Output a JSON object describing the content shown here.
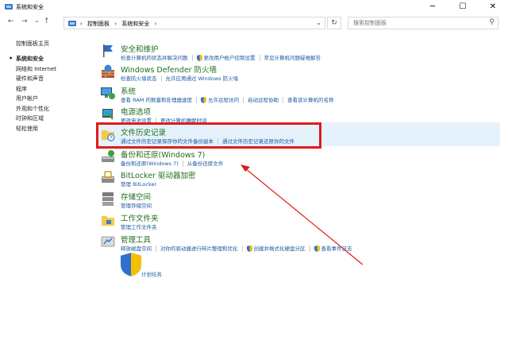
{
  "window": {
    "title": "系统和安全",
    "minimize": "─",
    "maximize": "☐",
    "close": "✕"
  },
  "address": {
    "back": "←",
    "forward": "→",
    "down": "⌄",
    "up": "↑",
    "crumbs": [
      "›",
      "控制面板",
      "›",
      "系统和安全",
      "›"
    ],
    "dropdown": "⌄",
    "refresh": "↻",
    "search_placeholder": "搜索控制面板",
    "search_icon": "⚲"
  },
  "sidebar": {
    "home": "控制面板主页",
    "items": [
      {
        "label": "系统和安全",
        "active": true
      },
      {
        "label": "网络和 Internet"
      },
      {
        "label": "硬件和声音"
      },
      {
        "label": "程序"
      },
      {
        "label": "用户帐户"
      },
      {
        "label": "外观和个性化"
      },
      {
        "label": "时钟和区域"
      },
      {
        "label": "轻松使用"
      }
    ]
  },
  "categories": {
    "security": {
      "title": "安全和维护",
      "links": [
        "检查计算机的状态并解决问题",
        "更改用户帐户控制设置",
        "常见计算机问题疑难解答"
      ]
    },
    "firewall": {
      "title": "Windows Defender 防火墙",
      "links": [
        "检查防火墙状态",
        "允许应用通过 Windows 防火墙"
      ]
    },
    "system": {
      "title": "系统",
      "links": [
        "查看 RAM 的数量和处理器速度",
        "允许远程访问",
        "启动远程协助",
        "查看该计算机的名称"
      ]
    },
    "power": {
      "title": "电源选项",
      "links": [
        "更改电池设置",
        "更改计算机睡眠时间"
      ]
    },
    "filehistory": {
      "title": "文件历史记录",
      "links": [
        "通过文件历史记录保存你的文件备份副本",
        "通过文件历史记录还原你的文件"
      ]
    },
    "backup": {
      "title": "备份和还原(Windows 7)",
      "links": [
        "备份和还原(Windows 7)",
        "从备份还原文件"
      ]
    },
    "bitlocker": {
      "title": "BitLocker 驱动器加密",
      "links": [
        "管理 BitLocker"
      ]
    },
    "storage": {
      "title": "存储空间",
      "links": [
        "管理存储空间"
      ]
    },
    "workfolders": {
      "title": "工作文件夹",
      "links": [
        "管理工作文件夹"
      ]
    },
    "admintools": {
      "title": "管理工具",
      "links": [
        "释放磁盘空间",
        "对你的驱动器进行碎片整理和优化",
        "创建并格式化硬盘分区",
        "查看事件日志"
      ],
      "links2": [
        "计划任务"
      ]
    }
  },
  "colors": {
    "highlight": "#e5f1fb",
    "annotation_red": "#e01b1b",
    "link_blue": "#1c5aa3",
    "title_green": "#1e6e1e"
  }
}
